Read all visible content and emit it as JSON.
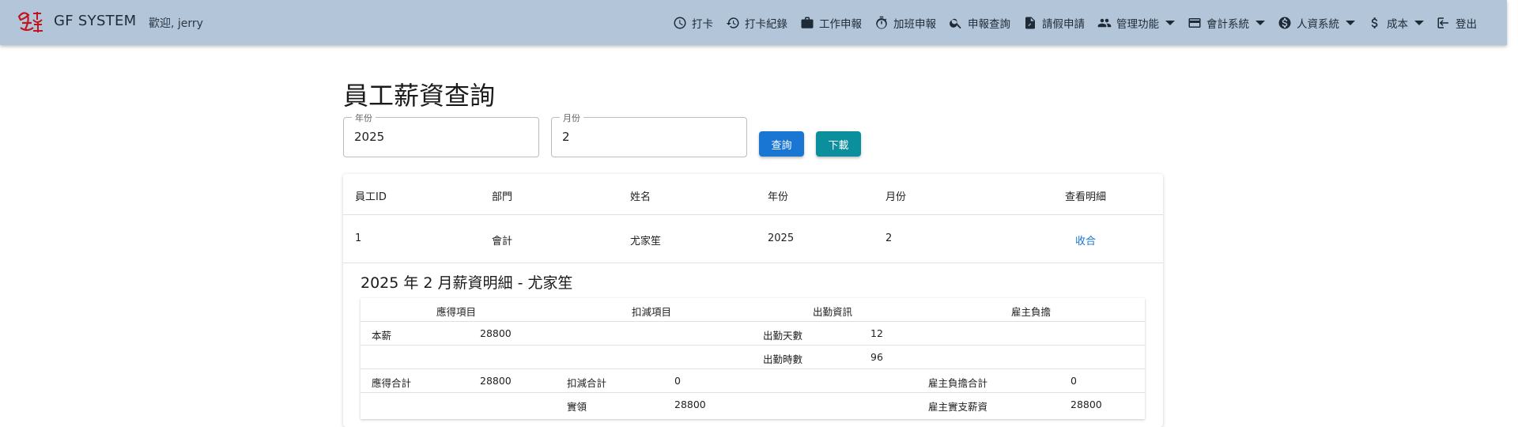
{
  "appbar": {
    "brand": "GF SYSTEM",
    "welcome": "歡迎, jerry",
    "nav": [
      {
        "label": "打卡",
        "icon": "clock-icon"
      },
      {
        "label": "打卡紀錄",
        "icon": "history-icon"
      },
      {
        "label": "工作申報",
        "icon": "briefcase-icon"
      },
      {
        "label": "加班申報",
        "icon": "stopwatch-icon"
      },
      {
        "label": "申報查詢",
        "icon": "search-icon"
      },
      {
        "label": "請假申請",
        "icon": "document-icon"
      },
      {
        "label": "管理功能",
        "icon": "people-icon",
        "dropdown": true
      },
      {
        "label": "會計系統",
        "icon": "credit-card-icon",
        "dropdown": true
      },
      {
        "label": "人資系統",
        "icon": "dollar-circle-icon",
        "dropdown": true
      },
      {
        "label": "成本",
        "icon": "dollar-icon",
        "dropdown": true
      },
      {
        "label": "登出",
        "icon": "logout-icon"
      }
    ]
  },
  "page": {
    "title": "員工薪資查詢",
    "year_label": "年份",
    "year_value": "2025",
    "month_label": "月份",
    "month_value": "2",
    "query_button": "查詢",
    "download_button": "下載"
  },
  "table": {
    "headers": [
      "員工ID",
      "部門",
      "姓名",
      "年份",
      "月份",
      "查看明細"
    ],
    "rows": [
      {
        "id": "1",
        "dept": "會計",
        "name": "尤家笙",
        "year": "2025",
        "month": "2",
        "action": "收合"
      }
    ]
  },
  "detail": {
    "title": "2025 年 2 月薪資明細 - 尤家笙",
    "headers": [
      "應得項目",
      "扣減項目",
      "出勤資訊",
      "雇主負擔"
    ],
    "rows": [
      [
        "本薪",
        "28800",
        "",
        "",
        "出勤天數",
        "12",
        "",
        ""
      ],
      [
        "",
        "",
        "",
        "",
        "出勤時數",
        "96",
        "",
        ""
      ],
      [
        "應得合計",
        "28800",
        "扣減合計",
        "0",
        "",
        "",
        "雇主負擔合計",
        "0"
      ],
      [
        "",
        "",
        "實領",
        "28800",
        "",
        "",
        "雇主實支薪資",
        "28800"
      ]
    ]
  },
  "colors": {
    "appbar": "#b3c5d9",
    "primary": "#1976d2",
    "download": "#0b8f9c"
  }
}
